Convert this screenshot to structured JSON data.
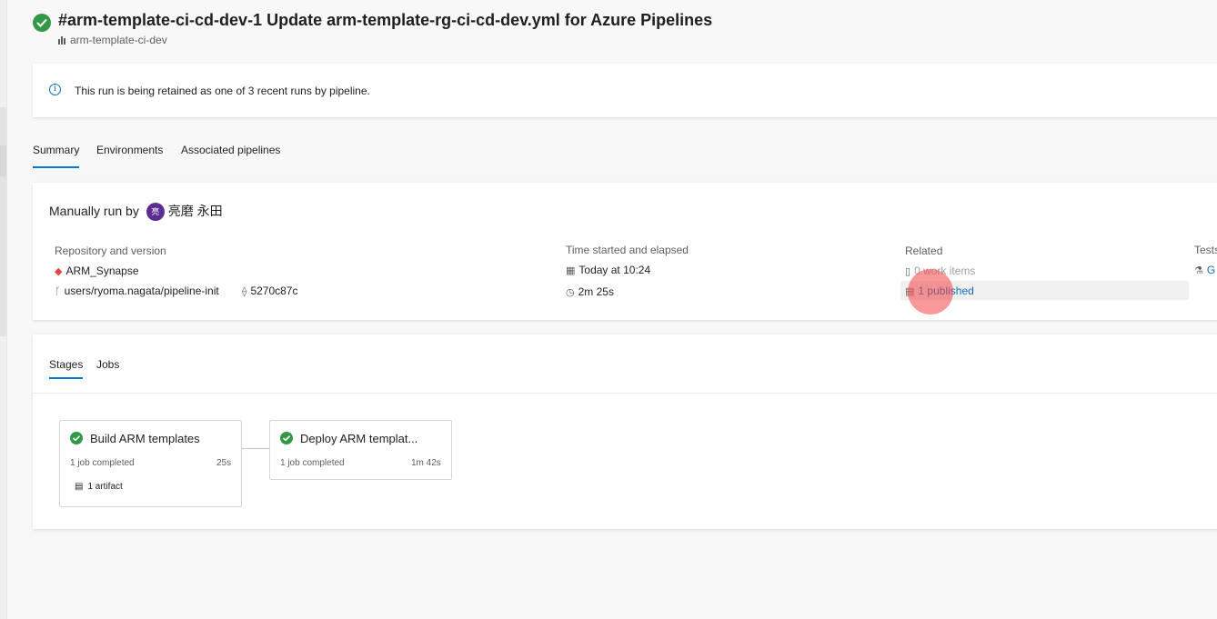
{
  "header": {
    "title": "#arm-template-ci-cd-dev-1 Update arm-template-rg-ci-cd-dev.yml for Azure Pipelines",
    "pipeline_name": "arm-template-ci-dev"
  },
  "info_banner": {
    "text": "This run is being retained as one of 3 recent runs by pipeline."
  },
  "tabs": [
    {
      "label": "Summary"
    },
    {
      "label": "Environments"
    },
    {
      "label": "Associated pipelines"
    }
  ],
  "summary": {
    "run_by_prefix": "Manually run by",
    "user_initial": "亮",
    "user_name": "亮磨 永田",
    "repo": {
      "label": "Repository and version",
      "name": "ARM_Synapse",
      "branch": "users/ryoma.nagata/pipeline-init",
      "commit": "5270c87c"
    },
    "time": {
      "label": "Time started and elapsed",
      "started": "Today at 10:24",
      "elapsed": "2m 25s"
    },
    "related": {
      "label": "Related",
      "work_items": "0 work items",
      "published": "1 published"
    },
    "tests": {
      "label": "Tests",
      "value": "G"
    }
  },
  "stages_section": {
    "tabs": [
      {
        "label": "Stages"
      },
      {
        "label": "Jobs"
      }
    ],
    "stages": [
      {
        "name": "Build ARM templates",
        "jobs": "1 job completed",
        "duration": "25s",
        "artifact": "1 artifact"
      },
      {
        "name": "Deploy ARM templat...",
        "jobs": "1 job completed",
        "duration": "1m 42s"
      }
    ]
  },
  "colors": {
    "success": "#339947",
    "accent": "#0078d4",
    "link": "#106ebe",
    "avatar": "#5c2d91",
    "click_marker": "#f44346"
  }
}
